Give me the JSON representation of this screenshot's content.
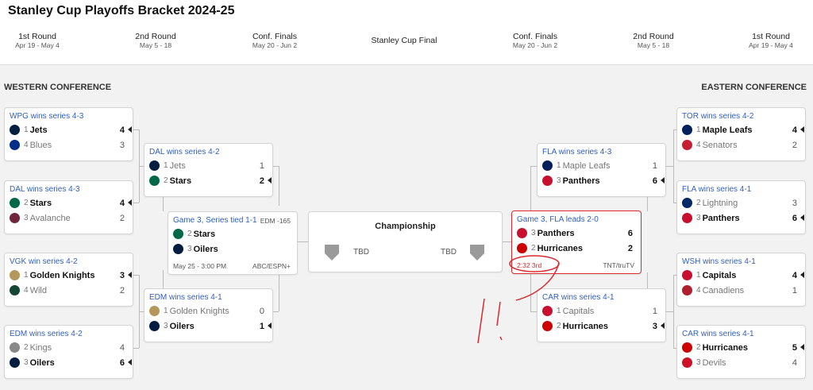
{
  "title": "Stanley Cup Playoffs Bracket 2024-25",
  "rounds": [
    {
      "name": "1st Round",
      "dates": "Apr 19 - May 4"
    },
    {
      "name": "2nd Round",
      "dates": "May 5 - 18"
    },
    {
      "name": "Conf. Finals",
      "dates": "May 20 - Jun 2"
    },
    {
      "name": "Stanley Cup Final",
      "dates": ""
    },
    {
      "name": "Conf. Finals",
      "dates": "May 20 - Jun 2"
    },
    {
      "name": "2nd Round",
      "dates": "May 5 - 18"
    },
    {
      "name": "1st Round",
      "dates": "Apr 19 - May 4"
    }
  ],
  "west_label": "WESTERN CONFERENCE",
  "east_label": "EASTERN CONFERENCE",
  "series": {
    "w1": {
      "status": "WPG wins series 4-3",
      "teams": [
        {
          "seed": "1",
          "name": "Jets",
          "score": "4",
          "win": true,
          "color": "#041e42"
        },
        {
          "seed": "4",
          "name": "Blues",
          "score": "3",
          "win": false,
          "color": "#002f87"
        }
      ]
    },
    "w2": {
      "status": "DAL wins series 4-3",
      "teams": [
        {
          "seed": "2",
          "name": "Stars",
          "score": "4",
          "win": true,
          "color": "#006847"
        },
        {
          "seed": "3",
          "name": "Avalanche",
          "score": "2",
          "win": false,
          "color": "#6f263d"
        }
      ]
    },
    "w3": {
      "status": "VGK win series 4-2",
      "teams": [
        {
          "seed": "1",
          "name": "Golden Knights",
          "score": "3",
          "win": true,
          "color": "#b4975a"
        },
        {
          "seed": "4",
          "name": "Wild",
          "score": "2",
          "win": false,
          "color": "#154734"
        }
      ]
    },
    "w4": {
      "status": "EDM wins series 4-2",
      "teams": [
        {
          "seed": "2",
          "name": "Kings",
          "score": "4",
          "win": false,
          "color": "#888888"
        },
        {
          "seed": "3",
          "name": "Oilers",
          "score": "6",
          "win": true,
          "color": "#041e42"
        }
      ]
    },
    "w5": {
      "status": "DAL wins series 4-2",
      "teams": [
        {
          "seed": "1",
          "name": "Jets",
          "score": "1",
          "win": false,
          "color": "#041e42"
        },
        {
          "seed": "2",
          "name": "Stars",
          "score": "2",
          "win": true,
          "color": "#006847"
        }
      ]
    },
    "w6": {
      "status": "EDM wins series 4-1",
      "teams": [
        {
          "seed": "1",
          "name": "Golden Knights",
          "score": "0",
          "win": false,
          "color": "#b4975a"
        },
        {
          "seed": "3",
          "name": "Oilers",
          "score": "1",
          "win": true,
          "color": "#041e42"
        }
      ]
    },
    "w7": {
      "status": "Game 3, Series tied 1-1",
      "odds": "EDM -165",
      "time": "May 25 - 3:00 PM",
      "network": "ABC/ESPN+",
      "teams": [
        {
          "seed": "2",
          "name": "Stars",
          "score": "",
          "win": true,
          "color": "#006847"
        },
        {
          "seed": "3",
          "name": "Oilers",
          "score": "",
          "win": true,
          "color": "#041e42"
        }
      ]
    },
    "e7": {
      "status": "Game 3, FLA leads 2-0",
      "clock": "2:32 3rd",
      "network": "TNT/truTV",
      "teams": [
        {
          "seed": "3",
          "name": "Panthers",
          "score": "6",
          "win": true,
          "color": "#c8102e"
        },
        {
          "seed": "2",
          "name": "Hurricanes",
          "score": "2",
          "win": true,
          "color": "#cc0000"
        }
      ]
    },
    "e5": {
      "status": "FLA wins series 4-3",
      "teams": [
        {
          "seed": "1",
          "name": "Maple Leafs",
          "score": "1",
          "win": false,
          "color": "#00205b"
        },
        {
          "seed": "3",
          "name": "Panthers",
          "score": "6",
          "win": true,
          "color": "#c8102e"
        }
      ]
    },
    "e6": {
      "status": "CAR wins series 4-1",
      "teams": [
        {
          "seed": "1",
          "name": "Capitals",
          "score": "1",
          "win": false,
          "color": "#c8102e"
        },
        {
          "seed": "2",
          "name": "Hurricanes",
          "score": "3",
          "win": true,
          "color": "#cc0000"
        }
      ]
    },
    "e1": {
      "status": "TOR wins series 4-2",
      "teams": [
        {
          "seed": "1",
          "name": "Maple Leafs",
          "score": "4",
          "win": true,
          "color": "#00205b"
        },
        {
          "seed": "4",
          "name": "Senators",
          "score": "2",
          "win": false,
          "color": "#c52032"
        }
      ]
    },
    "e2": {
      "status": "FLA wins series 4-1",
      "teams": [
        {
          "seed": "2",
          "name": "Lightning",
          "score": "3",
          "win": false,
          "color": "#002868"
        },
        {
          "seed": "3",
          "name": "Panthers",
          "score": "6",
          "win": true,
          "color": "#c8102e"
        }
      ]
    },
    "e3": {
      "status": "WSH wins series 4-1",
      "teams": [
        {
          "seed": "1",
          "name": "Capitals",
          "score": "4",
          "win": true,
          "color": "#c8102e"
        },
        {
          "seed": "4",
          "name": "Canadiens",
          "score": "1",
          "win": false,
          "color": "#af1e2d"
        }
      ]
    },
    "e4": {
      "status": "CAR wins series 4-1",
      "teams": [
        {
          "seed": "2",
          "name": "Hurricanes",
          "score": "5",
          "win": true,
          "color": "#cc0000"
        },
        {
          "seed": "3",
          "name": "Devils",
          "score": "4",
          "win": false,
          "color": "#ce1126"
        }
      ]
    }
  },
  "championship": {
    "title": "Championship",
    "left_tbd": "TBD",
    "right_tbd": "TBD"
  }
}
